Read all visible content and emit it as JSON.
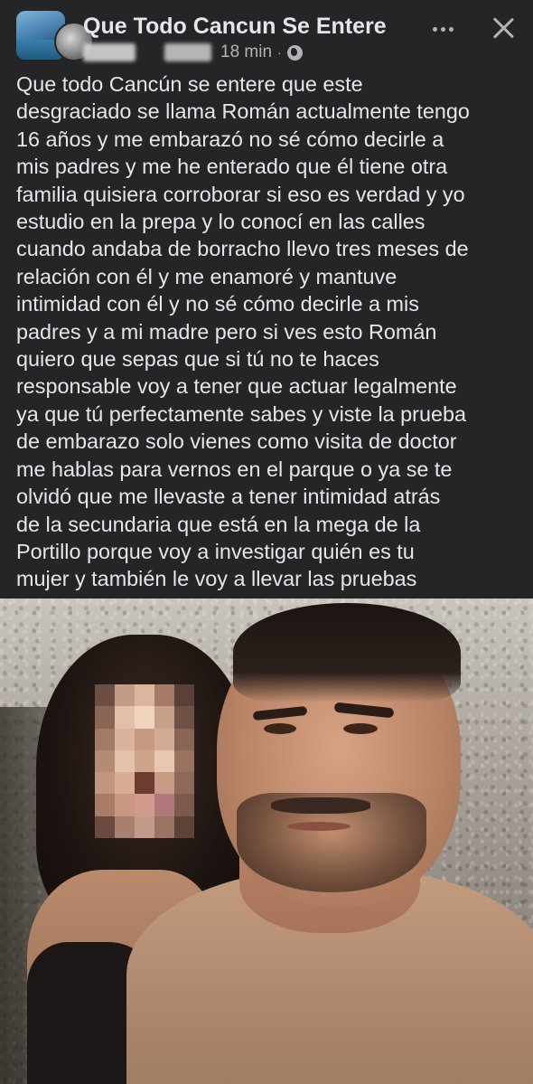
{
  "header": {
    "page_name": "Que Todo Cancun Se Entere",
    "time": "18 min",
    "separator": "·",
    "audience_icon": "globe-icon",
    "more_icon": "more-horizontal-icon",
    "close_icon": "close-icon"
  },
  "post": {
    "lines": [
      "Que todo Cancún se entere que este",
      "desgraciado se llama Román actualmente tengo",
      "16 años y me embarazó no sé cómo decirle a",
      "mis padres y me he enterado que él tiene otra",
      "familia quisiera corroborar si eso es verdad y yo",
      "estudio en la prepa y lo conocí en las calles",
      "cuando andaba de borracho llevo tres meses de",
      "relación con él y me enamoré y mantuve",
      "intimidad con él y no sé cómo decirle a mis",
      "padres y a mi madre pero si ves esto Román",
      "quiero que sepas que si tú no te haces",
      "responsable voy a tener que actuar legalmente",
      "ya que tú perfectamente sabes y viste la prueba",
      "de embarazo solo vienes como visita de doctor",
      "me hablas para vernos en el parque o ya se te",
      "olvidó que me llevaste a tener intimidad atrás",
      "de la secundaria que está en la mega de la",
      "Portillo porque voy a investigar quién es tu",
      "mujer y también le voy a llevar las pruebas"
    ]
  },
  "colors": {
    "background": "#242526",
    "primary_text": "#e4e6eb",
    "secondary_text": "#b0b3b8"
  }
}
